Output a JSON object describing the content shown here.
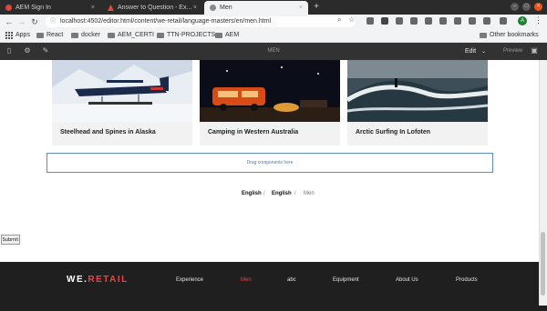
{
  "browser": {
    "tabs": [
      {
        "title": "AEM Sign In",
        "active": false,
        "favicon_color": "#e0453a"
      },
      {
        "title": "Answer to Question - Ex...",
        "active": false,
        "favicon_color": "#e04a3a"
      },
      {
        "title": "Men",
        "active": true,
        "favicon_color": "#8a8a8a"
      }
    ],
    "new_tab_label": "+",
    "window_controls": {
      "minimize": "–",
      "maximize": "□",
      "close": "×"
    },
    "url": "localhost:4502/editor.html/content/we-retail/language-masters/en/men.html",
    "bookmarks": [
      "Apps",
      "React",
      "docker",
      "AEM_CERTI",
      "TTN-PROJECTS",
      "AEM"
    ],
    "other_bookmarks": "Other bookmarks",
    "avatar_letter": "A"
  },
  "aem": {
    "page_title": "MEN",
    "edit_label": "Edit",
    "preview_label": "Preview"
  },
  "cards": [
    {
      "title": "Steelhead and Spines in Alaska"
    },
    {
      "title": "Camping in Western Australia"
    },
    {
      "title": "Arctic Surfing In Lofoten"
    }
  ],
  "dropzone_text": "Drag components here",
  "breadcrumb": [
    "English",
    "English",
    "Men"
  ],
  "breadcrumb_sep": "/",
  "submit_label": "Submit",
  "footer": {
    "logo_main": "WE.",
    "logo_accent": "RETAIL",
    "nav": [
      "Experience",
      "Men",
      "abc",
      "Equipment",
      "About Us",
      "Products"
    ],
    "active": "Men",
    "accent_color": "#ea4444"
  }
}
